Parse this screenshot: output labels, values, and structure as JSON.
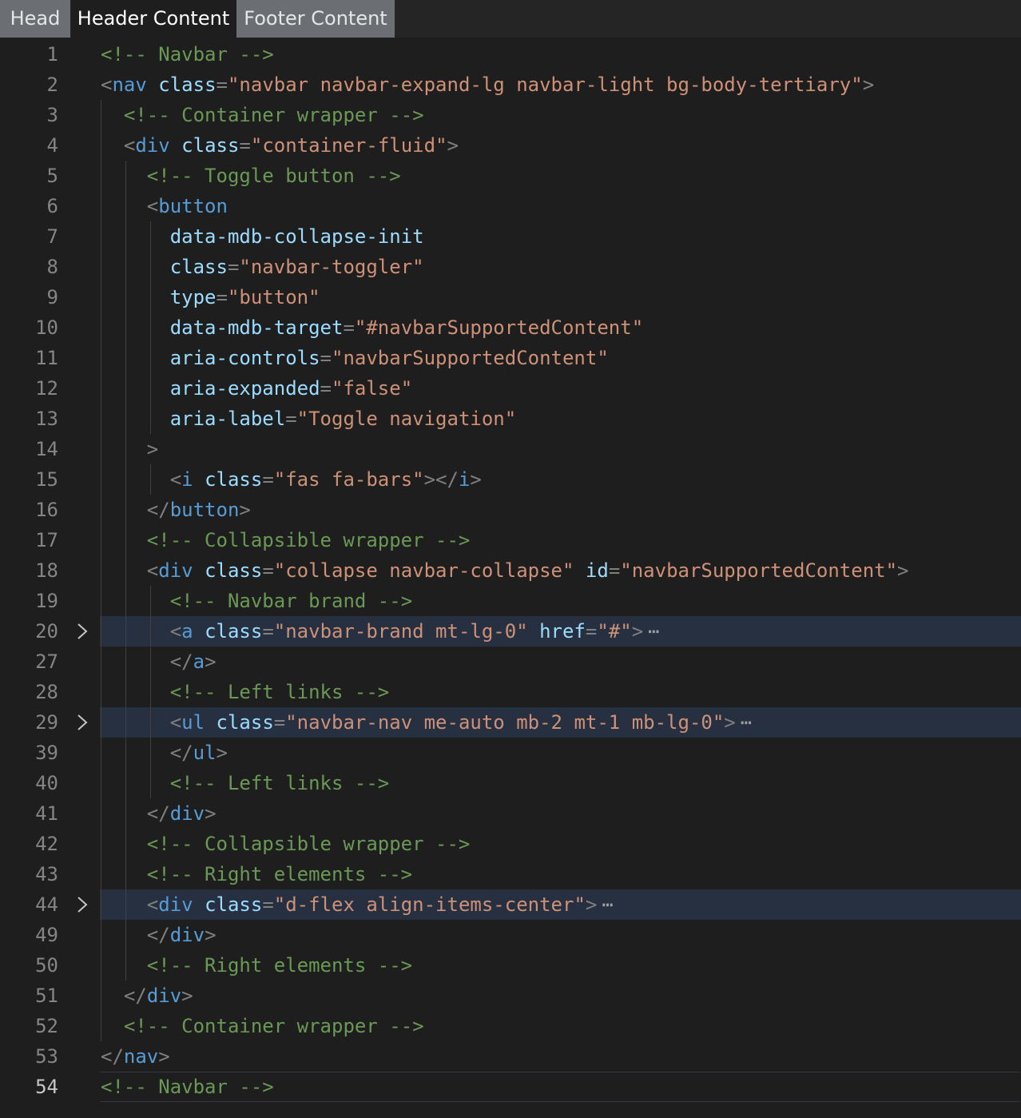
{
  "tabs": [
    {
      "label": "Head",
      "active": false
    },
    {
      "label": "Header Content",
      "active": true
    },
    {
      "label": "Footer Content",
      "active": false
    }
  ],
  "colors": {
    "background": "#1e1e1e",
    "comment": "#6a9955",
    "tag": "#569cd6",
    "attribute": "#9cdcfe",
    "string": "#ce9178",
    "punctuation": "#808080",
    "line_number": "#858585",
    "highlight": "#263040"
  },
  "editor": {
    "current_line": "54",
    "folded_lines": [
      "20",
      "29",
      "44"
    ],
    "lines": [
      {
        "num": "1",
        "indent": 0,
        "tokens": [
          [
            "c",
            "<!-- Navbar -->"
          ]
        ]
      },
      {
        "num": "2",
        "indent": 0,
        "tokens": [
          [
            "p",
            "<"
          ],
          [
            "t",
            "nav"
          ],
          [
            "e",
            " "
          ],
          [
            "a",
            "class"
          ],
          [
            "p",
            "="
          ],
          [
            "s",
            "\"navbar navbar-expand-lg navbar-light bg-body-tertiary\""
          ],
          [
            "p",
            ">"
          ]
        ]
      },
      {
        "num": "3",
        "indent": 1,
        "tokens": [
          [
            "c",
            "<!-- Container wrapper -->"
          ]
        ]
      },
      {
        "num": "4",
        "indent": 1,
        "tokens": [
          [
            "p",
            "<"
          ],
          [
            "t",
            "div"
          ],
          [
            "e",
            " "
          ],
          [
            "a",
            "class"
          ],
          [
            "p",
            "="
          ],
          [
            "s",
            "\"container-fluid\""
          ],
          [
            "p",
            ">"
          ]
        ]
      },
      {
        "num": "5",
        "indent": 2,
        "tokens": [
          [
            "c",
            "<!-- Toggle button -->"
          ]
        ]
      },
      {
        "num": "6",
        "indent": 2,
        "tokens": [
          [
            "p",
            "<"
          ],
          [
            "t",
            "button"
          ]
        ]
      },
      {
        "num": "7",
        "indent": 3,
        "tokens": [
          [
            "a",
            "data-mdb-collapse-init"
          ]
        ]
      },
      {
        "num": "8",
        "indent": 3,
        "tokens": [
          [
            "a",
            "class"
          ],
          [
            "p",
            "="
          ],
          [
            "s",
            "\"navbar-toggler\""
          ]
        ]
      },
      {
        "num": "9",
        "indent": 3,
        "tokens": [
          [
            "a",
            "type"
          ],
          [
            "p",
            "="
          ],
          [
            "s",
            "\"button\""
          ]
        ]
      },
      {
        "num": "10",
        "indent": 3,
        "tokens": [
          [
            "a",
            "data-mdb-target"
          ],
          [
            "p",
            "="
          ],
          [
            "s",
            "\"#navbarSupportedContent\""
          ]
        ]
      },
      {
        "num": "11",
        "indent": 3,
        "tokens": [
          [
            "a",
            "aria-controls"
          ],
          [
            "p",
            "="
          ],
          [
            "s",
            "\"navbarSupportedContent\""
          ]
        ]
      },
      {
        "num": "12",
        "indent": 3,
        "tokens": [
          [
            "a",
            "aria-expanded"
          ],
          [
            "p",
            "="
          ],
          [
            "s",
            "\"false\""
          ]
        ]
      },
      {
        "num": "13",
        "indent": 3,
        "tokens": [
          [
            "a",
            "aria-label"
          ],
          [
            "p",
            "="
          ],
          [
            "s",
            "\"Toggle navigation\""
          ]
        ]
      },
      {
        "num": "14",
        "indent": 2,
        "tokens": [
          [
            "p",
            ">"
          ]
        ]
      },
      {
        "num": "15",
        "indent": 3,
        "tokens": [
          [
            "p",
            "<"
          ],
          [
            "t",
            "i"
          ],
          [
            "e",
            " "
          ],
          [
            "a",
            "class"
          ],
          [
            "p",
            "="
          ],
          [
            "s",
            "\"fas fa-bars\""
          ],
          [
            "p",
            "></"
          ],
          [
            "t",
            "i"
          ],
          [
            "p",
            ">"
          ]
        ]
      },
      {
        "num": "16",
        "indent": 2,
        "tokens": [
          [
            "p",
            "</"
          ],
          [
            "t",
            "button"
          ],
          [
            "p",
            ">"
          ]
        ]
      },
      {
        "num": "17",
        "indent": 2,
        "tokens": [
          [
            "c",
            "<!-- Collapsible wrapper -->"
          ]
        ]
      },
      {
        "num": "18",
        "indent": 2,
        "tokens": [
          [
            "p",
            "<"
          ],
          [
            "t",
            "div"
          ],
          [
            "e",
            " "
          ],
          [
            "a",
            "class"
          ],
          [
            "p",
            "="
          ],
          [
            "s",
            "\"collapse navbar-collapse\""
          ],
          [
            "e",
            " "
          ],
          [
            "a",
            "id"
          ],
          [
            "p",
            "="
          ],
          [
            "s",
            "\"navbarSupportedContent\""
          ],
          [
            "p",
            ">"
          ]
        ]
      },
      {
        "num": "19",
        "indent": 3,
        "tokens": [
          [
            "c",
            "<!-- Navbar brand -->"
          ]
        ]
      },
      {
        "num": "20",
        "indent": 3,
        "folded": true,
        "tokens": [
          [
            "p",
            "<"
          ],
          [
            "t",
            "a"
          ],
          [
            "e",
            " "
          ],
          [
            "a",
            "class"
          ],
          [
            "p",
            "="
          ],
          [
            "s",
            "\"navbar-brand mt-lg-0\""
          ],
          [
            "e",
            " "
          ],
          [
            "a",
            "href"
          ],
          [
            "p",
            "="
          ],
          [
            "s",
            "\"#\""
          ],
          [
            "p",
            ">"
          ],
          [
            "d",
            "⋯"
          ]
        ]
      },
      {
        "num": "27",
        "indent": 3,
        "tokens": [
          [
            "p",
            "</"
          ],
          [
            "t",
            "a"
          ],
          [
            "p",
            ">"
          ]
        ]
      },
      {
        "num": "28",
        "indent": 3,
        "tokens": [
          [
            "c",
            "<!-- Left links -->"
          ]
        ]
      },
      {
        "num": "29",
        "indent": 3,
        "folded": true,
        "tokens": [
          [
            "p",
            "<"
          ],
          [
            "t",
            "ul"
          ],
          [
            "e",
            " "
          ],
          [
            "a",
            "class"
          ],
          [
            "p",
            "="
          ],
          [
            "s",
            "\"navbar-nav me-auto mb-2 mt-1 mb-lg-0\""
          ],
          [
            "p",
            ">"
          ],
          [
            "d",
            "⋯"
          ]
        ]
      },
      {
        "num": "39",
        "indent": 3,
        "tokens": [
          [
            "p",
            "</"
          ],
          [
            "t",
            "ul"
          ],
          [
            "p",
            ">"
          ]
        ]
      },
      {
        "num": "40",
        "indent": 3,
        "tokens": [
          [
            "c",
            "<!-- Left links -->"
          ]
        ]
      },
      {
        "num": "41",
        "indent": 2,
        "tokens": [
          [
            "p",
            "</"
          ],
          [
            "t",
            "div"
          ],
          [
            "p",
            ">"
          ]
        ]
      },
      {
        "num": "42",
        "indent": 2,
        "tokens": [
          [
            "c",
            "<!-- Collapsible wrapper -->"
          ]
        ]
      },
      {
        "num": "43",
        "indent": 2,
        "tokens": [
          [
            "c",
            "<!-- Right elements -->"
          ]
        ]
      },
      {
        "num": "44",
        "indent": 2,
        "folded": true,
        "tokens": [
          [
            "p",
            "<"
          ],
          [
            "t",
            "div"
          ],
          [
            "e",
            " "
          ],
          [
            "a",
            "class"
          ],
          [
            "p",
            "="
          ],
          [
            "s",
            "\"d-flex align-items-center\""
          ],
          [
            "p",
            ">"
          ],
          [
            "d",
            "⋯"
          ]
        ]
      },
      {
        "num": "49",
        "indent": 2,
        "tokens": [
          [
            "p",
            "</"
          ],
          [
            "t",
            "div"
          ],
          [
            "p",
            ">"
          ]
        ]
      },
      {
        "num": "50",
        "indent": 2,
        "tokens": [
          [
            "c",
            "<!-- Right elements -->"
          ]
        ]
      },
      {
        "num": "51",
        "indent": 1,
        "tokens": [
          [
            "p",
            "</"
          ],
          [
            "t",
            "div"
          ],
          [
            "p",
            ">"
          ]
        ]
      },
      {
        "num": "52",
        "indent": 1,
        "tokens": [
          [
            "c",
            "<!-- Container wrapper -->"
          ]
        ]
      },
      {
        "num": "53",
        "indent": 0,
        "tokens": [
          [
            "p",
            "</"
          ],
          [
            "t",
            "nav"
          ],
          [
            "p",
            ">"
          ]
        ]
      },
      {
        "num": "54",
        "indent": 0,
        "current": true,
        "tokens": [
          [
            "c",
            "<!-- Navbar -->"
          ]
        ]
      }
    ]
  }
}
